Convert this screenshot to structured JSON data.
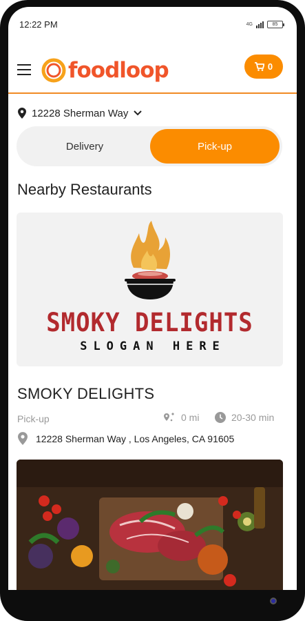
{
  "status_bar": {
    "time": "12:22 PM",
    "network": "4G",
    "battery": "85"
  },
  "header": {
    "menu_icon": "hamburger-icon",
    "logo_text": "foodloop",
    "cart_icon": "cart-icon",
    "cart_count": "0",
    "accent_color": "#fb8c00",
    "logo_color": "#f0552a"
  },
  "location": {
    "icon": "location-pin-icon",
    "address": "12228 Sherman Way",
    "chevron_icon": "chevron-down-icon"
  },
  "mode_toggle": {
    "delivery_label": "Delivery",
    "pickup_label": "Pick-up",
    "selected": "Pick-up"
  },
  "section": {
    "title": "Nearby Restaurants"
  },
  "restaurant": {
    "banner_title": "SMOKY DELIGHTS",
    "banner_slogan": "SLOGAN HERE",
    "name": "SMOKY DELIGHTS",
    "mode": "Pick-up",
    "distance": "0 mi",
    "time": "20-30 min",
    "address": "12228 Sherman Way , Los Angeles, CA 91605"
  }
}
